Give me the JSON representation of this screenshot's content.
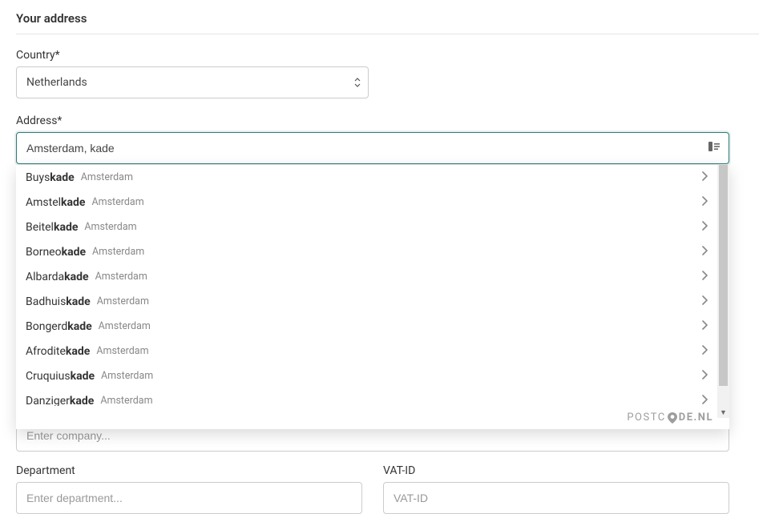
{
  "section": {
    "title": "Your address"
  },
  "country": {
    "label": "Country*",
    "value": "Netherlands"
  },
  "address": {
    "label": "Address*",
    "value": "Amsterdam, kade"
  },
  "suggestions": [
    {
      "prefix": "Buys",
      "match": "kade",
      "city": "Amsterdam"
    },
    {
      "prefix": "Amstel",
      "match": "kade",
      "city": "Amsterdam"
    },
    {
      "prefix": "Beitel",
      "match": "kade",
      "city": "Amsterdam"
    },
    {
      "prefix": "Borneo",
      "match": "kade",
      "city": "Amsterdam"
    },
    {
      "prefix": "Albarda",
      "match": "kade",
      "city": "Amsterdam"
    },
    {
      "prefix": "Badhuis",
      "match": "kade",
      "city": "Amsterdam"
    },
    {
      "prefix": "Bongerd",
      "match": "kade",
      "city": "Amsterdam"
    },
    {
      "prefix": "Afrodite",
      "match": "kade",
      "city": "Amsterdam"
    },
    {
      "prefix": "Cruquius",
      "match": "kade",
      "city": "Amsterdam"
    },
    {
      "prefix": "Danziger",
      "match": "kade",
      "city": "Amsterdam"
    }
  ],
  "provider": {
    "pre": "POSTC",
    "post": "DE.NL"
  },
  "company": {
    "placeholder": "Enter company..."
  },
  "department": {
    "label": "Department",
    "placeholder": "Enter department..."
  },
  "vat": {
    "label": "VAT-ID",
    "placeholder": "VAT-ID"
  }
}
